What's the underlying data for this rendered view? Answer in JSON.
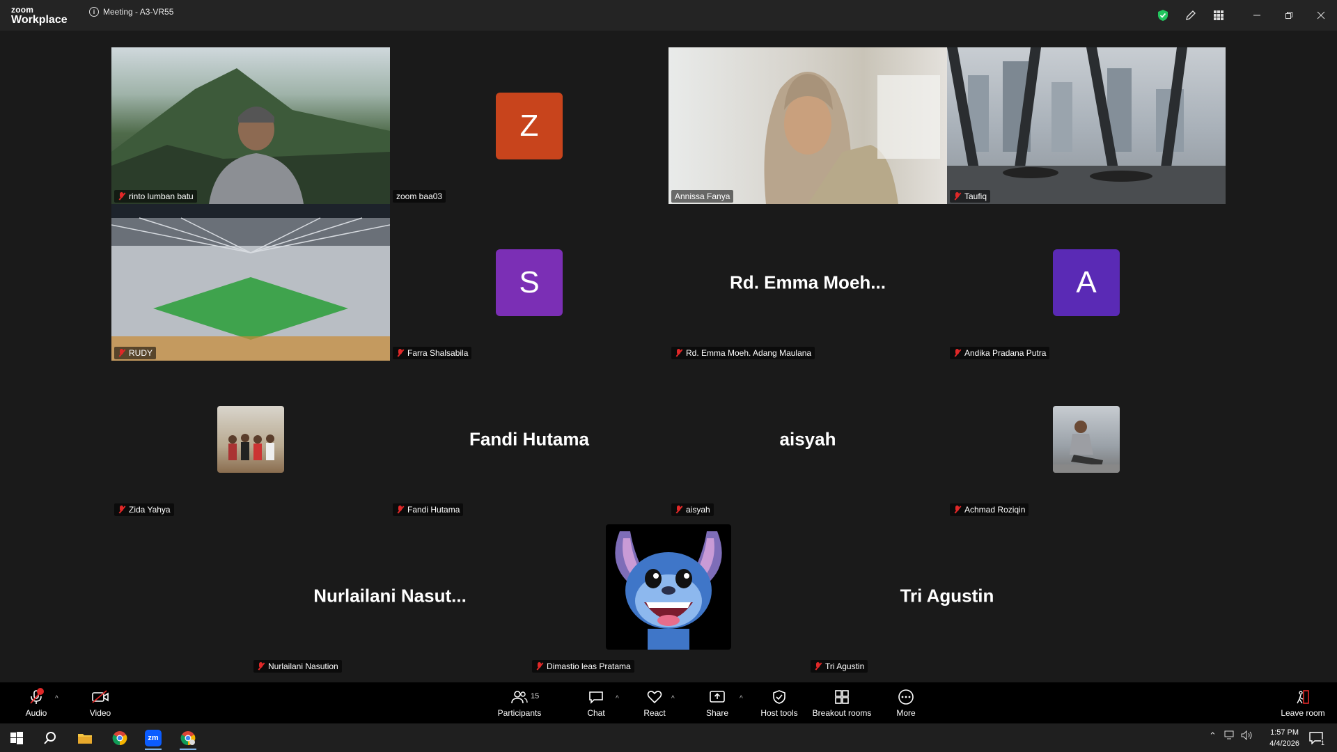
{
  "app": {
    "brand_top": "zoom",
    "brand_bottom": "Workplace"
  },
  "meeting": {
    "title": "Meeting - A3-VR55"
  },
  "participants": [
    {
      "name": "rinto lumban batu",
      "muted": true,
      "kind": "video"
    },
    {
      "name": "zoom baa03",
      "muted": false,
      "kind": "letter",
      "letter": "Z",
      "color": "#c8441c"
    },
    {
      "name": "Annissa Fanya",
      "muted": false,
      "kind": "video",
      "active": true
    },
    {
      "name": "Taufiq",
      "muted": true,
      "kind": "video"
    },
    {
      "name": "RUDY",
      "muted": true,
      "kind": "video"
    },
    {
      "name": "Farra Shalsabila",
      "muted": true,
      "kind": "letter",
      "letter": "S",
      "color": "#7b2fb5"
    },
    {
      "name": "Rd. Emma Moeh. Adang Maulana",
      "muted": true,
      "kind": "text",
      "display": "Rd.  Emma  Moeh..."
    },
    {
      "name": "Andika Pradana Putra",
      "muted": true,
      "kind": "letter",
      "letter": "A",
      "color": "#5a2ab5"
    },
    {
      "name": "Zida Yahya",
      "muted": true,
      "kind": "thumb"
    },
    {
      "name": "Fandi Hutama",
      "muted": true,
      "kind": "text",
      "display": "Fandi Hutama"
    },
    {
      "name": "aisyah",
      "muted": true,
      "kind": "text",
      "display": "aisyah"
    },
    {
      "name": "Achmad Roziqin",
      "muted": true,
      "kind": "thumb"
    },
    {
      "name": "Nurlailani Nasution",
      "muted": true,
      "kind": "text",
      "display": "Nurlailani  Nasut..."
    },
    {
      "name": "Dimastio leas Pratama",
      "muted": true,
      "kind": "thumb-large"
    },
    {
      "name": "Tri Agustin",
      "muted": true,
      "kind": "text",
      "display": "Tri Agustin"
    }
  ],
  "toolbar": {
    "audio": "Audio",
    "video": "Video",
    "participants": "Participants",
    "participants_count": "15",
    "chat": "Chat",
    "react": "React",
    "share": "Share",
    "host_tools": "Host tools",
    "breakout_rooms": "Breakout rooms",
    "more": "More",
    "leave": "Leave room"
  },
  "taskbar": {
    "time": "1:57 PM",
    "date": "4/4/2026",
    "notifications": "1"
  },
  "colors": {
    "active_speaker": "#20c997",
    "mute": "#e02828",
    "security_shield": "#22c55e"
  }
}
